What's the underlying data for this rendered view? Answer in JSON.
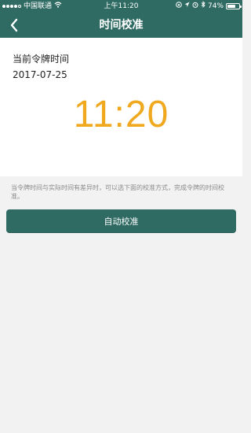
{
  "status_bar": {
    "carrier": "中国联通",
    "time": "上午11:20",
    "battery": "74%",
    "battery_level": 0.74
  },
  "nav": {
    "title": "时间校准",
    "back_icon": "chevron-left-icon"
  },
  "token": {
    "label": "当前令牌时间",
    "date": "2017-07-25",
    "time": "11:20"
  },
  "note": "当令牌时间与实际时间有差异时，可以选下面的校准方式，完成令牌的时间校准。",
  "auto_button_label": "自动校准",
  "colors": {
    "header": "#2f6b63",
    "time": "#f0a81e",
    "background": "#f2f2f2"
  }
}
